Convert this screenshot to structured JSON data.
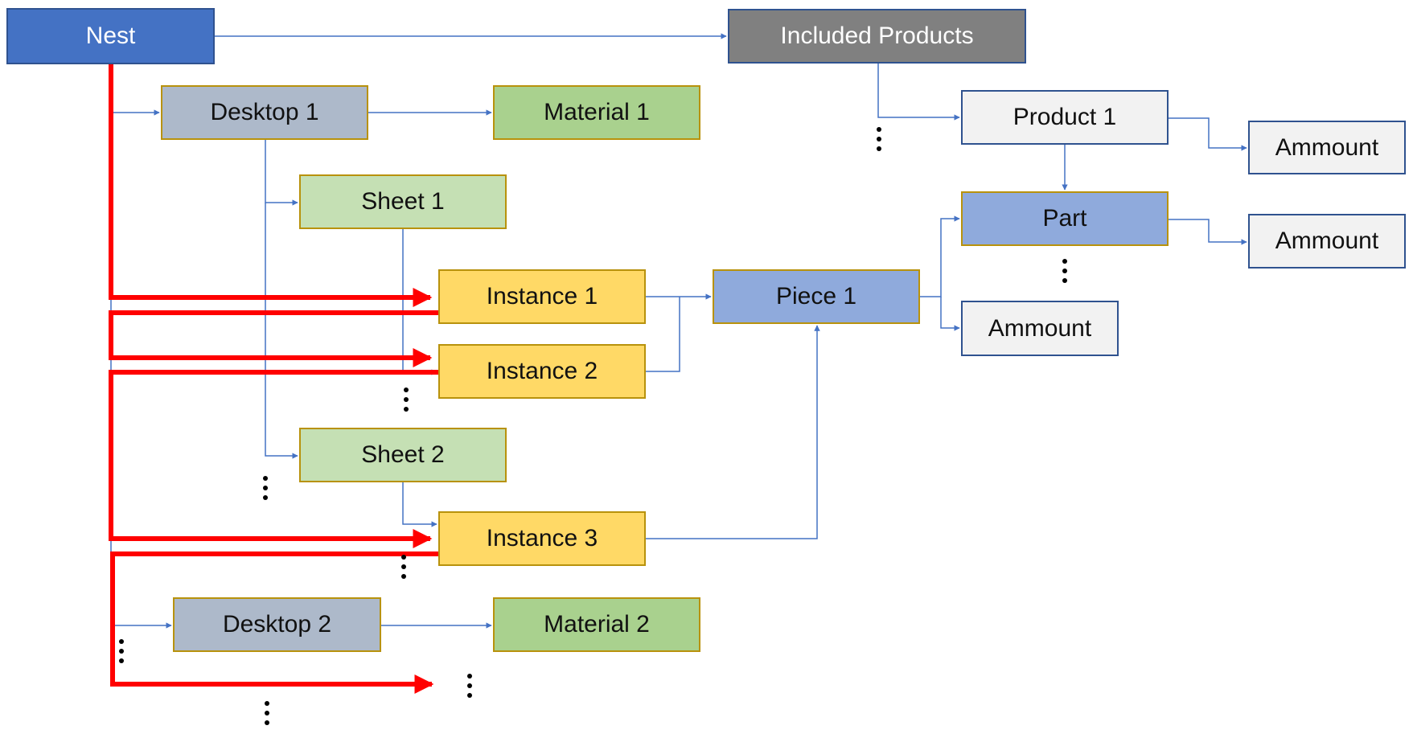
{
  "diagram": {
    "nodes": {
      "nest": "Nest",
      "included_products": "Included Products",
      "desktop_1": "Desktop 1",
      "material_1": "Material 1",
      "sheet_1": "Sheet 1",
      "instance_1": "Instance 1",
      "instance_2": "Instance 2",
      "sheet_2": "Sheet 2",
      "instance_3": "Instance 3",
      "desktop_2": "Desktop 2",
      "material_2": "Material 2",
      "piece_1": "Piece 1",
      "product_1": "Product 1",
      "part": "Part",
      "ammount_product": "Ammount",
      "ammount_part": "Ammount",
      "ammount_piece": "Ammount"
    },
    "colors": {
      "connector": "#4472c4",
      "highlight_path": "#ff0000",
      "nest_fill": "#4472c4",
      "included_products_fill": "#808080",
      "desktop_fill": "#adb9ca",
      "material_fill": "#a9d18e",
      "sheet_fill": "#c5e0b4",
      "instance_fill": "#ffd966",
      "piece_fill": "#8faadc",
      "amount_fill": "#f2f2f2"
    },
    "edges": [
      [
        "Nest",
        "Included Products"
      ],
      [
        "Nest",
        "Desktop 1"
      ],
      [
        "Desktop 1",
        "Material 1"
      ],
      [
        "Desktop 1",
        "Sheet 1"
      ],
      [
        "Desktop 1",
        "Sheet 2"
      ],
      [
        "Sheet 1",
        "Instance 2"
      ],
      [
        "Sheet 2",
        "Instance 3"
      ],
      [
        "Instance 1",
        "Piece 1"
      ],
      [
        "Instance 2",
        "Piece 1"
      ],
      [
        "Instance 3",
        "Piece 1"
      ],
      [
        "Piece 1",
        "Part"
      ],
      [
        "Piece 1",
        "Ammount"
      ],
      [
        "Included Products",
        "Product 1"
      ],
      [
        "Product 1",
        "Ammount"
      ],
      [
        "Product 1",
        "Part"
      ],
      [
        "Part",
        "Ammount"
      ],
      [
        "Nest",
        "Desktop 2"
      ],
      [
        "Desktop 2",
        "Material 2"
      ]
    ],
    "highlight_path": [
      "Nest",
      "Instance 1",
      "Instance 2",
      "Instance 3",
      "..."
    ],
    "ellipsis": "⋮"
  }
}
